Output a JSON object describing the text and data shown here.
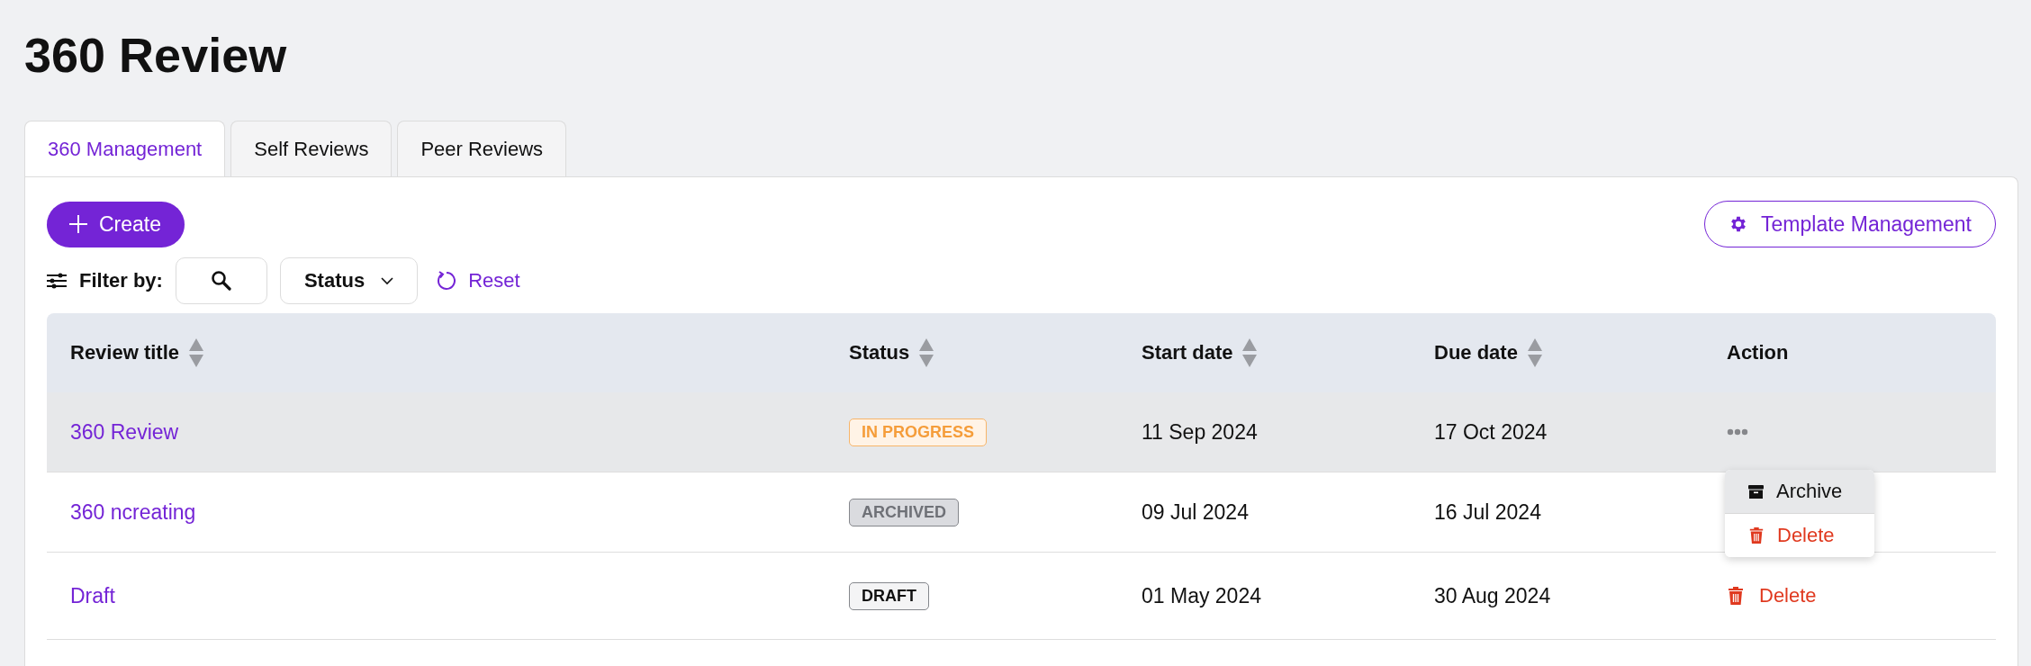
{
  "page_title": "360 Review",
  "tabs": [
    {
      "label": "360 Management",
      "selected": true
    },
    {
      "label": "Self Reviews",
      "selected": false
    },
    {
      "label": "Peer Reviews",
      "selected": false
    }
  ],
  "create_button": "Create",
  "template_button": "Template Management",
  "filter": {
    "label": "Filter by:",
    "status_dropdown": "Status",
    "reset": "Reset"
  },
  "table": {
    "columns": [
      {
        "label": "Review title",
        "sortable": true
      },
      {
        "label": "Status",
        "sortable": true
      },
      {
        "label": "Start date",
        "sortable": true
      },
      {
        "label": "Due date",
        "sortable": true
      },
      {
        "label": "Action",
        "sortable": false
      }
    ],
    "rows": [
      {
        "title": "360 Review",
        "status": {
          "label": "IN PROGRESS",
          "kind": "progress"
        },
        "start": "11 Sep 2024",
        "due": "17 Oct 2024",
        "highlighted": true,
        "action": {
          "kind": "menu",
          "open": true,
          "items": [
            {
              "label": "Archive",
              "kind": "archive",
              "highlighted": true
            },
            {
              "label": "Delete",
              "kind": "delete",
              "highlighted": false
            }
          ]
        }
      },
      {
        "title": "360 ncreating",
        "status": {
          "label": "ARCHIVED",
          "kind": "archived"
        },
        "start": "09 Jul 2024",
        "due": "16 Jul 2024",
        "highlighted": false
      },
      {
        "title": "Draft",
        "status": {
          "label": "DRAFT",
          "kind": "draft"
        },
        "start": "01 May 2024",
        "due": "30 Aug 2024",
        "highlighted": false,
        "action": {
          "kind": "delete",
          "label": "Delete"
        }
      }
    ]
  }
}
